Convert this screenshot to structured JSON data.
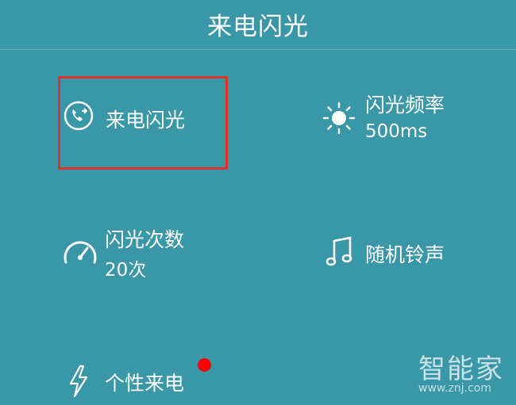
{
  "header": {
    "title": "来电闪光"
  },
  "tiles": {
    "incoming_flash": {
      "label": "来电闪光",
      "icon": "phone-icon"
    },
    "flash_frequency": {
      "label": "闪光频率",
      "value": "500ms",
      "icon": "sun-icon"
    },
    "flash_count": {
      "label": "闪光次数",
      "value": "20次",
      "icon": "speedometer-icon"
    },
    "random_ringtone": {
      "label": "随机铃声",
      "icon": "music-note-icon"
    },
    "personal_call": {
      "label": "个性来电",
      "icon": "lightning-icon",
      "badge_color": "#ff0000"
    }
  },
  "watermark": {
    "text": "智能家",
    "url": "www.znj.com"
  },
  "colors": {
    "background": "#3a97a8",
    "highlight": "#e0322c"
  }
}
